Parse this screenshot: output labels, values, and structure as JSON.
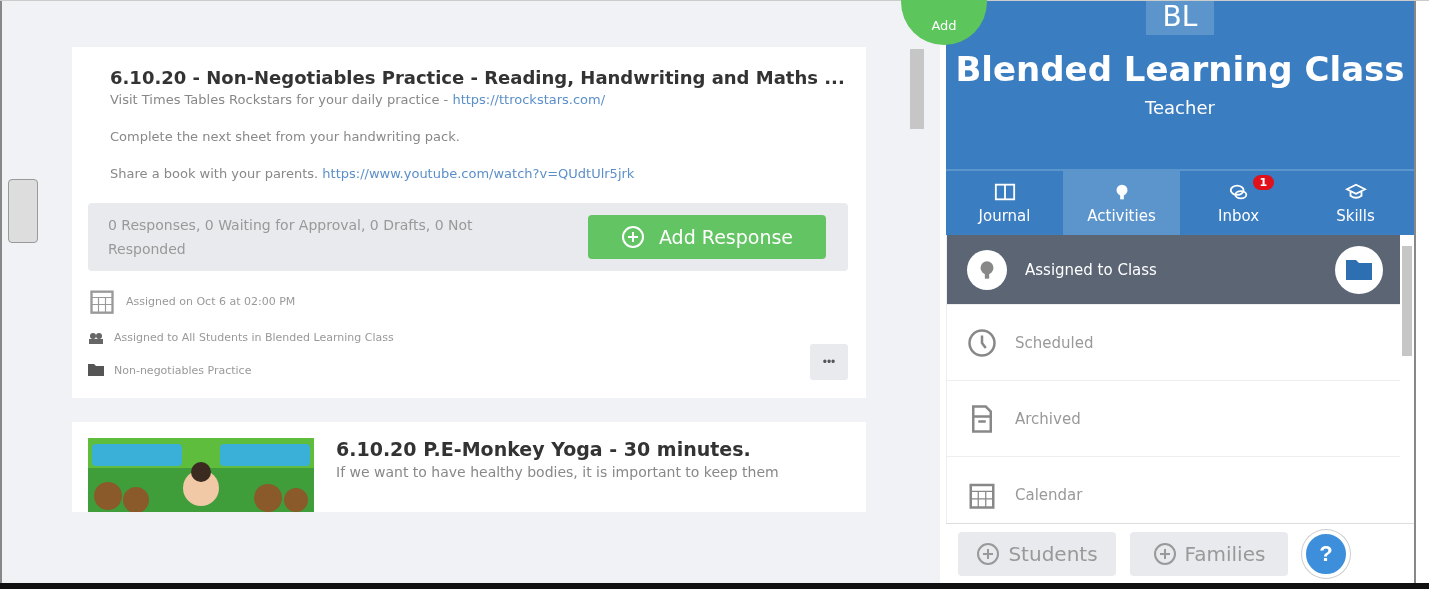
{
  "feed": {
    "cards": [
      {
        "kind": "activity",
        "title": "6.10.20 - Non-Negotiables Practice - Reading, Handwriting and Maths ...",
        "lines": [
          {
            "text": "Visit Times Tables Rockstars for your daily practice - ",
            "link": "https://ttrockstars.com/"
          },
          {
            "text": "Complete the next sheet from your handwriting pack."
          },
          {
            "text": "Share a book with your parents. ",
            "link": "https://www.youtube.com/watch?v=QUdtUlr5jrk"
          }
        ],
        "summary": "0 Responses, 0 Waiting for Approval, 0 Drafts, 0 Not Responded",
        "action": "Add Response",
        "meta": [
          {
            "kind": "calendar",
            "text": "Assigned on Oct 6 at 02:00 PM"
          },
          {
            "kind": "people",
            "text": "Assigned to All Students in Blended Learning Class"
          },
          {
            "kind": "folder",
            "text": "Non-negotiables Practice"
          }
        ],
        "more": "•••"
      },
      {
        "kind": "preview",
        "title": "6.10.20 P.E-Monkey Yoga - 30 minutes.",
        "lines": [
          {
            "text": "If we want to have healthy bodies, it is important to keep them"
          }
        ]
      }
    ]
  },
  "add_button": "Add",
  "class_panel": {
    "initials": "BL",
    "name": "Blended Learning Class",
    "role": "Teacher",
    "tabs": [
      {
        "label": "Journal",
        "kind": "book",
        "selected": false
      },
      {
        "label": "Activities",
        "kind": "bulb",
        "selected": true
      },
      {
        "label": "Inbox",
        "kind": "chat",
        "selected": false,
        "badge": "1"
      },
      {
        "label": "Skills",
        "kind": "cap",
        "selected": false
      }
    ],
    "items": [
      {
        "label": "Assigned to Class",
        "kind": "bulb",
        "selected": true
      },
      {
        "label": "Scheduled",
        "kind": "clock",
        "selected": false
      },
      {
        "label": "Archived",
        "kind": "archive",
        "selected": false
      },
      {
        "label": "Calendar",
        "kind": "calendar",
        "selected": false
      }
    ],
    "buttons": [
      "Students",
      "Families"
    ],
    "help": "?"
  }
}
